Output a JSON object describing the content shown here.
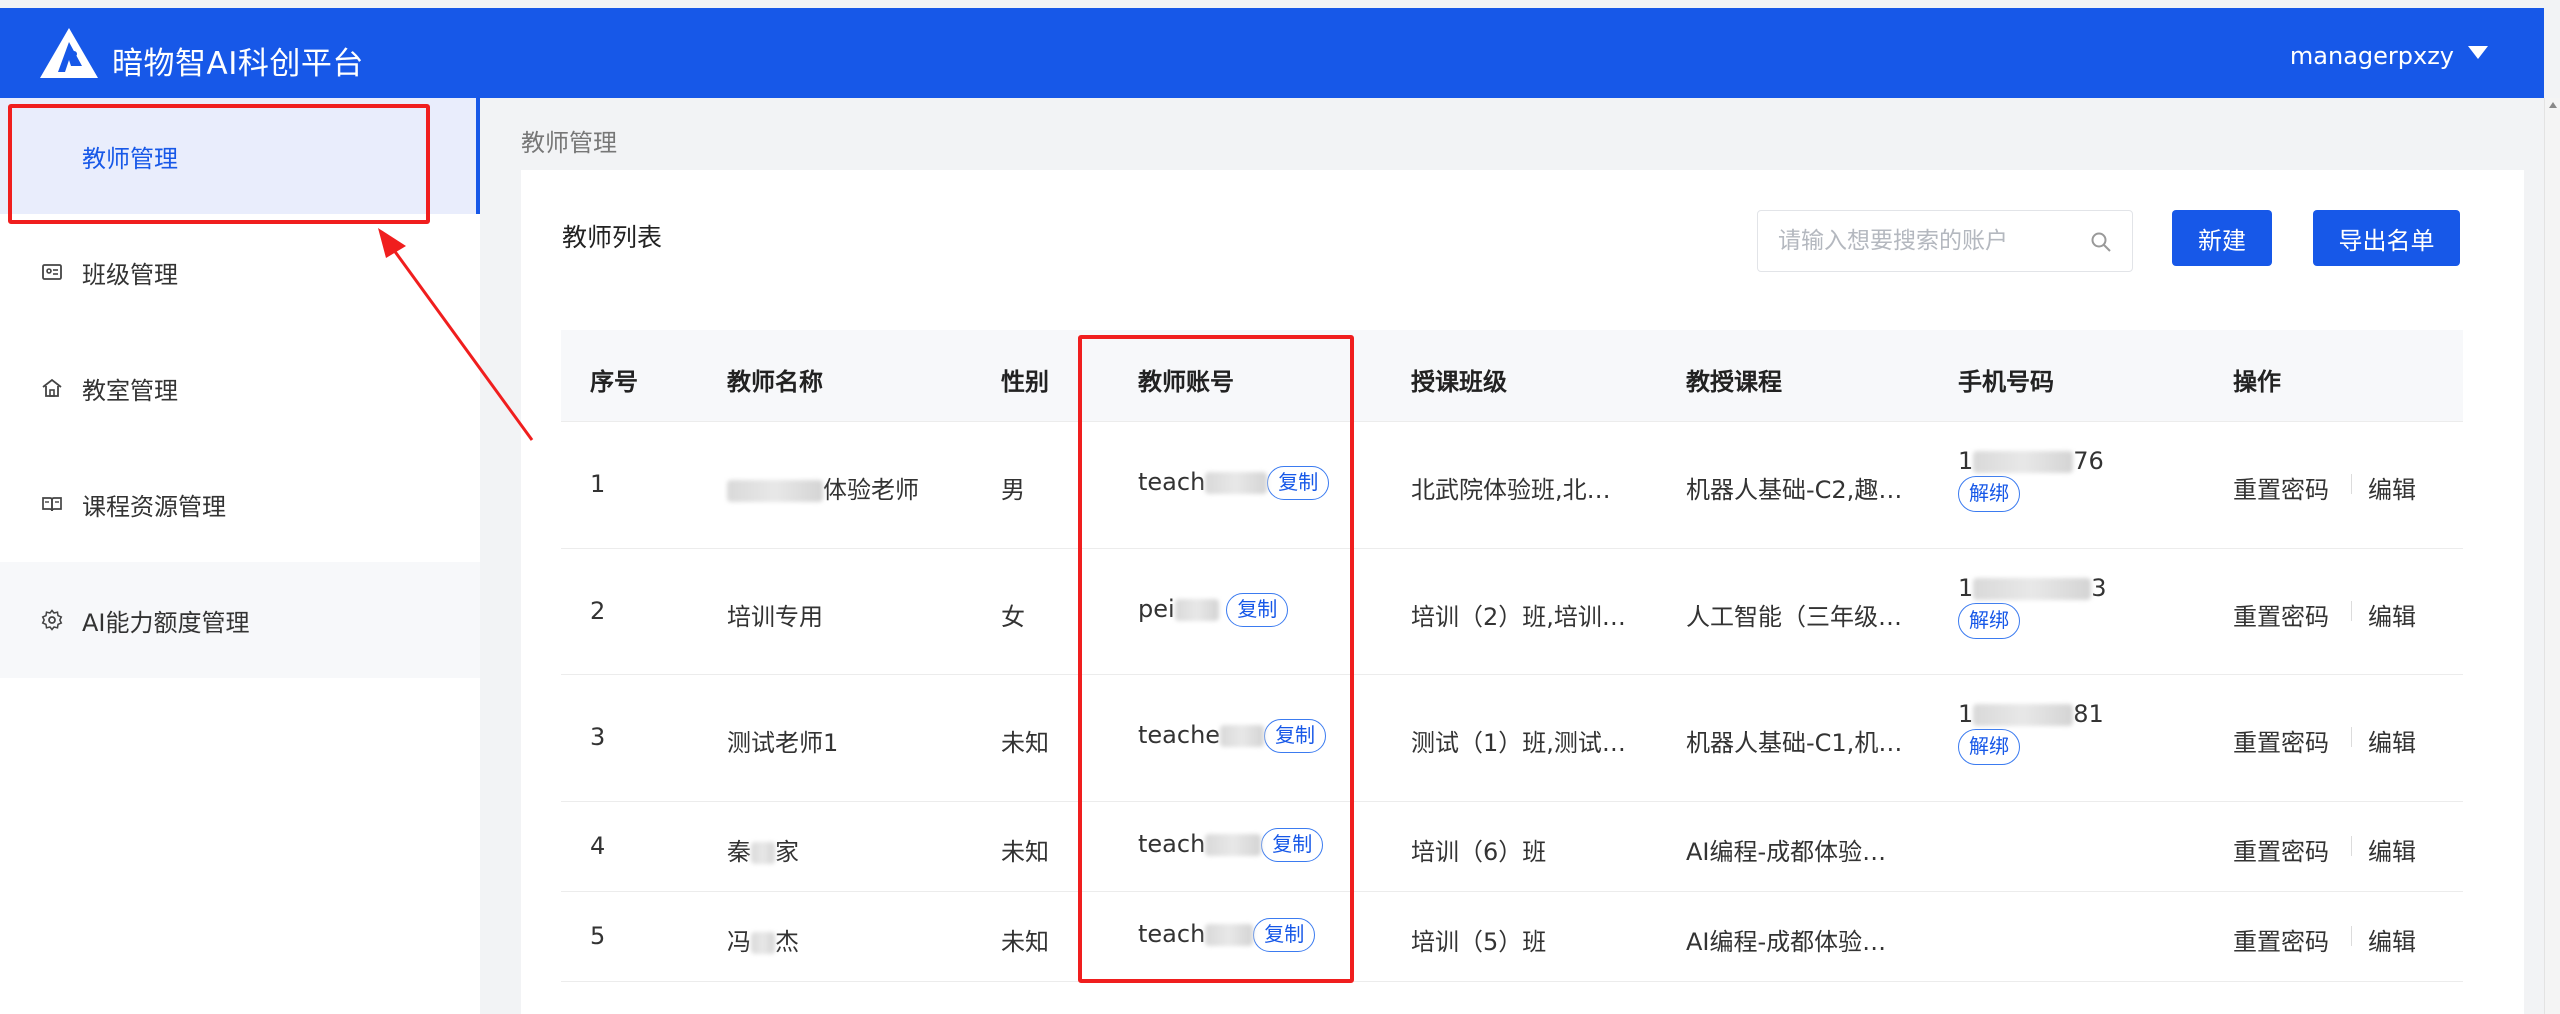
{
  "app": {
    "title": "暗物智AI科创平台",
    "username": "managerpxzy"
  },
  "sidebar": {
    "items": [
      {
        "label": "教师管理"
      },
      {
        "label": "班级管理"
      },
      {
        "label": "教室管理"
      },
      {
        "label": "课程资源管理"
      },
      {
        "label": "AI能力额度管理"
      }
    ]
  },
  "breadcrumb": "教师管理",
  "panel": {
    "title": "教师列表",
    "search_placeholder": "请输入想要搜索的账户",
    "new_label": "新建",
    "export_label": "导出名单"
  },
  "table": {
    "headers": [
      "序号",
      "教师名称",
      "性别",
      "教师账号",
      "授课班级",
      "教授课程",
      "手机号码",
      "操作"
    ],
    "copy_label": "复制",
    "unbind_label": "解绑",
    "reset_label": "重置密码",
    "edit_label": "编辑",
    "rows": [
      {
        "index": "1",
        "name_prefix": "",
        "name_suffix": "体验老师",
        "gender": "男",
        "account": "teach",
        "classes": "北武院体验班,北…",
        "courses": "机器人基础-C2,趣…",
        "phone_prefix": "1",
        "phone_suffix": "76"
      },
      {
        "index": "2",
        "name_prefix": "培训专用",
        "name_suffix": "",
        "gender": "女",
        "account": "pei",
        "classes": "培训（2）班,培训…",
        "courses": "人工智能（三年级…",
        "phone_prefix": "1",
        "phone_suffix": "3"
      },
      {
        "index": "3",
        "name_prefix": "测试老师1",
        "name_suffix": "",
        "gender": "未知",
        "account": "teache",
        "classes": "测试（1）班,测试…",
        "courses": "机器人基础-C1,机…",
        "phone_prefix": "1",
        "phone_suffix": "81"
      },
      {
        "index": "4",
        "name_prefix": "秦",
        "name_suffix": "家",
        "gender": "未知",
        "account": "teach",
        "classes": "培训（6）班",
        "courses": "AI编程-成都体验…",
        "phone_prefix": "",
        "phone_suffix": ""
      },
      {
        "index": "5",
        "name_prefix": "冯",
        "name_suffix": "杰",
        "gender": "未知",
        "account": "teach",
        "classes": "培训（5）班",
        "courses": "AI编程-成都体验…",
        "phone_prefix": "",
        "phone_suffix": ""
      }
    ]
  },
  "colors": {
    "brand": "#1758e8",
    "annotation": "#f01e1e"
  }
}
